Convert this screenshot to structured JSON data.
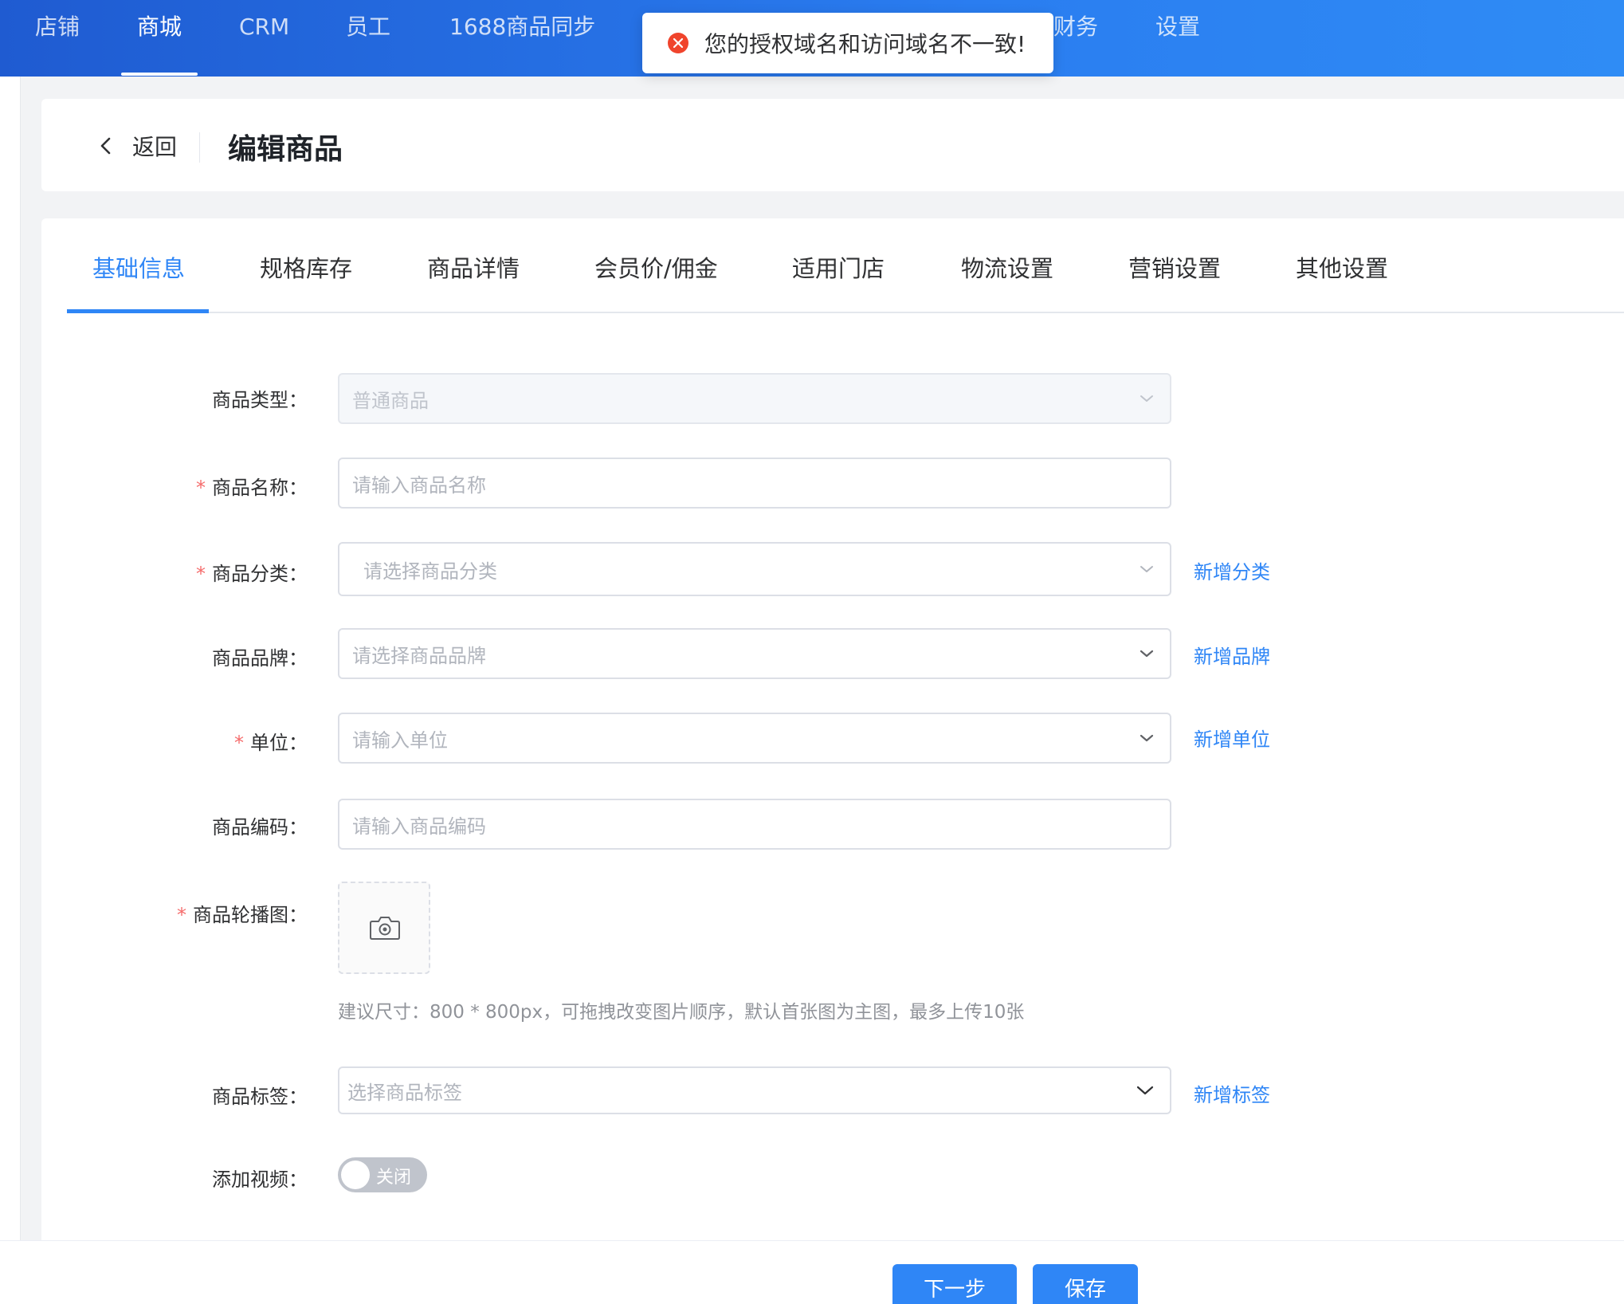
{
  "topnav": {
    "items": [
      "店铺",
      "商城",
      "CRM",
      "员工",
      "1688商品同步",
      "财务",
      "设置"
    ],
    "active_index": 1
  },
  "toast": {
    "type": "error",
    "message": "您的授权域名和访问域名不一致!"
  },
  "header": {
    "back_label": "返回",
    "title": "编辑商品"
  },
  "tabs": {
    "items": [
      "基础信息",
      "规格库存",
      "商品详情",
      "会员价/佣金",
      "适用门店",
      "物流设置",
      "营销设置",
      "其他设置"
    ],
    "active_index": 0
  },
  "form": {
    "type": {
      "label": "商品类型：",
      "value": "普通商品"
    },
    "name": {
      "label": "商品名称：",
      "placeholder": "请输入商品名称"
    },
    "category": {
      "label": "商品分类：",
      "placeholder": "请选择商品分类",
      "add_label": "新增分类"
    },
    "brand": {
      "label": "商品品牌：",
      "placeholder": "请选择商品品牌",
      "add_label": "新增品牌"
    },
    "unit": {
      "label": "单位：",
      "placeholder": "请输入单位",
      "add_label": "新增单位"
    },
    "code": {
      "label": "商品编码：",
      "placeholder": "请输入商品编码"
    },
    "carousel": {
      "label": "商品轮播图：",
      "hint": "建议尺寸：800 * 800px，可拖拽改变图片顺序，默认首张图为主图，最多上传10张"
    },
    "tags": {
      "label": "商品标签：",
      "placeholder": "选择商品标签",
      "add_label": "新增标签"
    },
    "video": {
      "label": "添加视频：",
      "switch_text": "关闭",
      "enabled": false
    },
    "required_mark": "*"
  },
  "footer": {
    "next_label": "下一步",
    "save_label": "保存"
  },
  "colors": {
    "primary": "#2f86f6",
    "nav_gradient_start": "#1f5bd1",
    "nav_gradient_end": "#2f8cf5",
    "error": "#f0442c",
    "required": "#f56c6c"
  }
}
